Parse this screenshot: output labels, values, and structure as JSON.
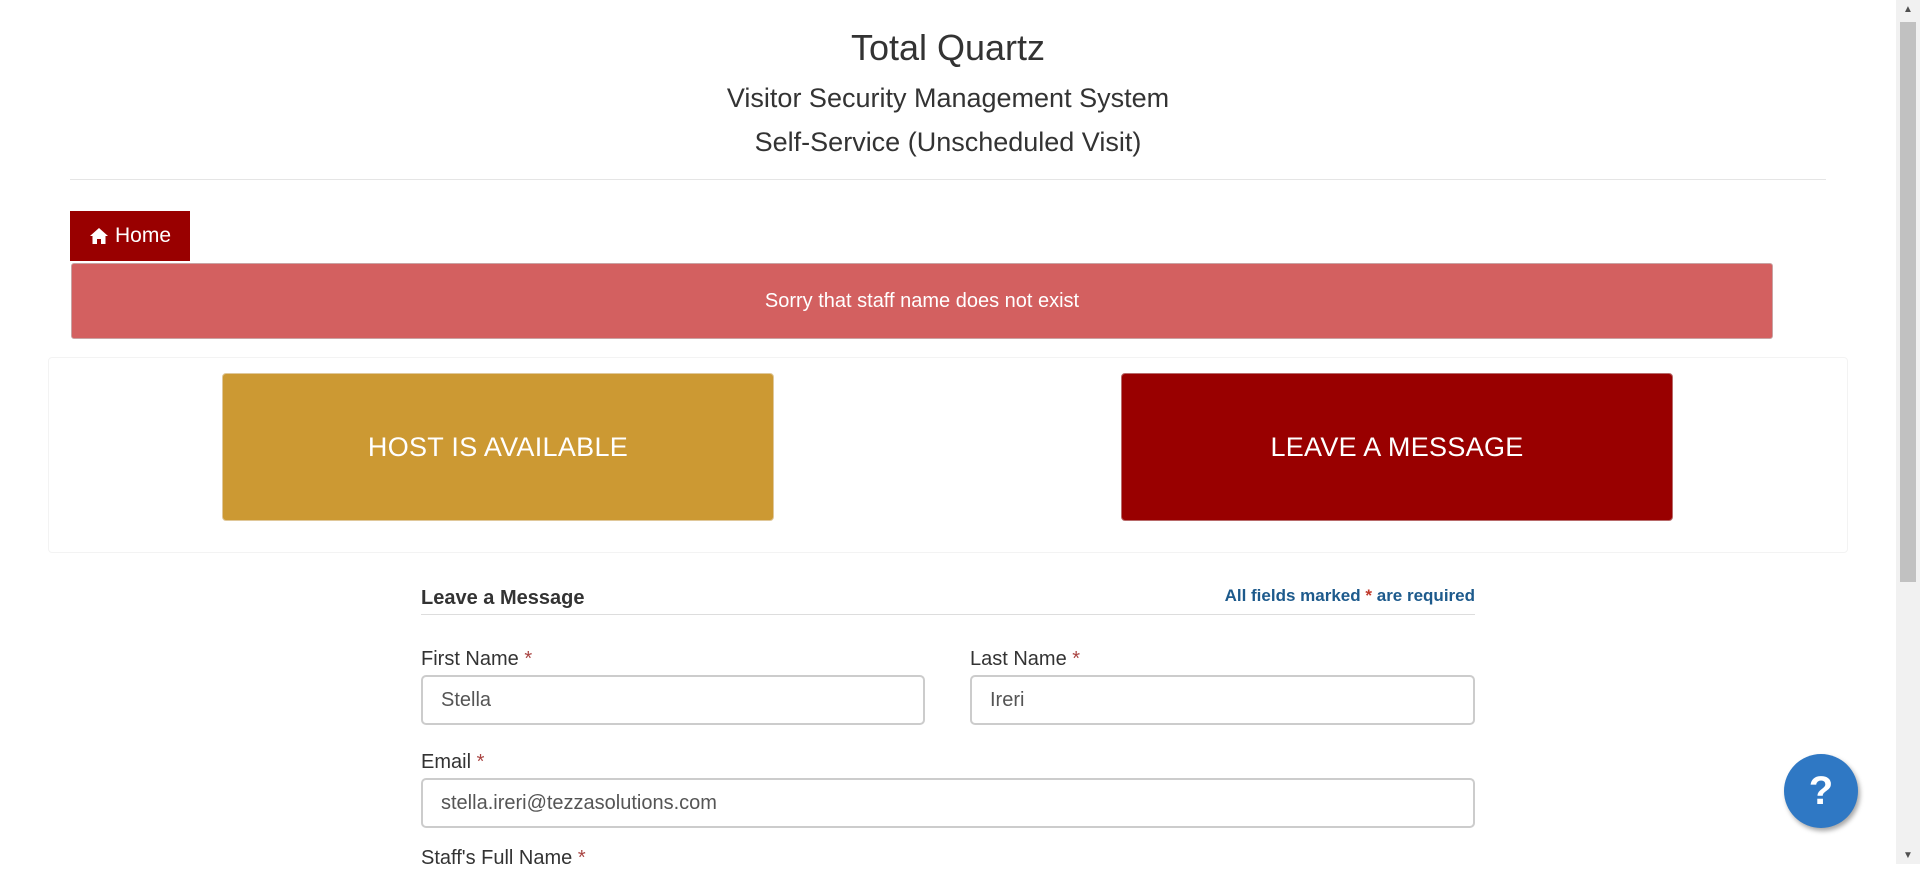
{
  "header": {
    "title": "Total Quartz",
    "subtitle": "Visitor Security Management System",
    "mode": "Self-Service (Unscheduled Visit)"
  },
  "nav": {
    "home_label": "Home",
    "home_icon": "home-icon"
  },
  "alert": {
    "message": "Sorry that staff name does not exist"
  },
  "actions": {
    "host_available": "HOST IS AVAILABLE",
    "leave_message": "LEAVE A MESSAGE"
  },
  "form": {
    "title": "Leave a Message",
    "required_note_prefix": "All fields marked",
    "required_note_star": "*",
    "required_note_suffix": "are required",
    "required_marker": "*",
    "first_name": {
      "label": "First Name",
      "value": "Stella"
    },
    "last_name": {
      "label": "Last Name",
      "value": "Ireri"
    },
    "email": {
      "label": "Email",
      "value": "stella.ireri@tezzasolutions.com"
    },
    "staff_full_name": {
      "label": "Staff's Full Name"
    }
  },
  "help": {
    "label": "?"
  },
  "colors": {
    "brand_red": "#990000",
    "gold": "#cc9933",
    "alert": "#d36060",
    "help_blue": "#2f78c4"
  }
}
